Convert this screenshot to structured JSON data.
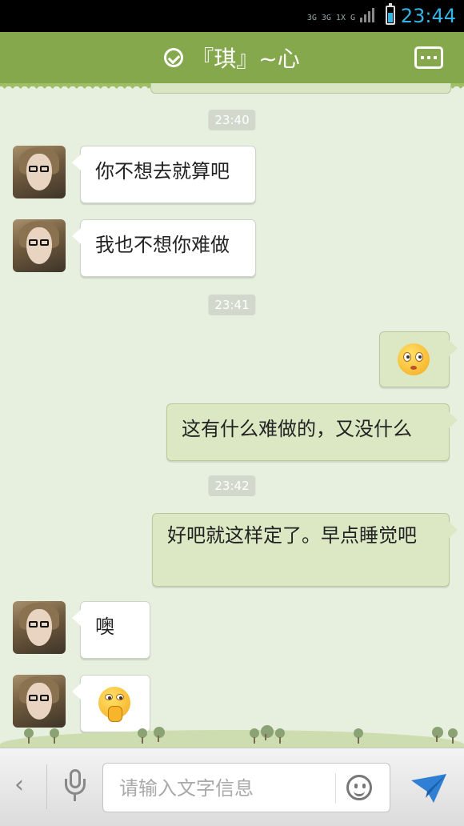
{
  "status_bar": {
    "network_labels": [
      "3G",
      "3G",
      "1X",
      "G"
    ],
    "time": "23:44"
  },
  "header": {
    "title": "『琪』~心"
  },
  "input_bar": {
    "placeholder": "请输入文字信息"
  },
  "messages": [
    {
      "kind": "time",
      "text": "23:40"
    },
    {
      "kind": "incoming",
      "text": "你不想去就算吧"
    },
    {
      "kind": "incoming",
      "text": "我也不想你难做"
    },
    {
      "kind": "time",
      "text": "23:41"
    },
    {
      "kind": "outgoing",
      "emoji": "blushing-face-icon"
    },
    {
      "kind": "outgoing",
      "text": "这有什么难做的，又没什么"
    },
    {
      "kind": "time",
      "text": "23:42"
    },
    {
      "kind": "outgoing",
      "text": "好吧就这样定了。早点睡觉吧"
    },
    {
      "kind": "incoming",
      "text": "噢"
    },
    {
      "kind": "incoming",
      "emoji": "thinking-face-icon"
    }
  ],
  "colors": {
    "header": "#85a84d",
    "background": "#e7efdf",
    "outgoing_bubble": "#dbe8c3",
    "incoming_bubble": "#ffffff",
    "clock": "#33b5e5",
    "send": "#2f7fd4"
  }
}
